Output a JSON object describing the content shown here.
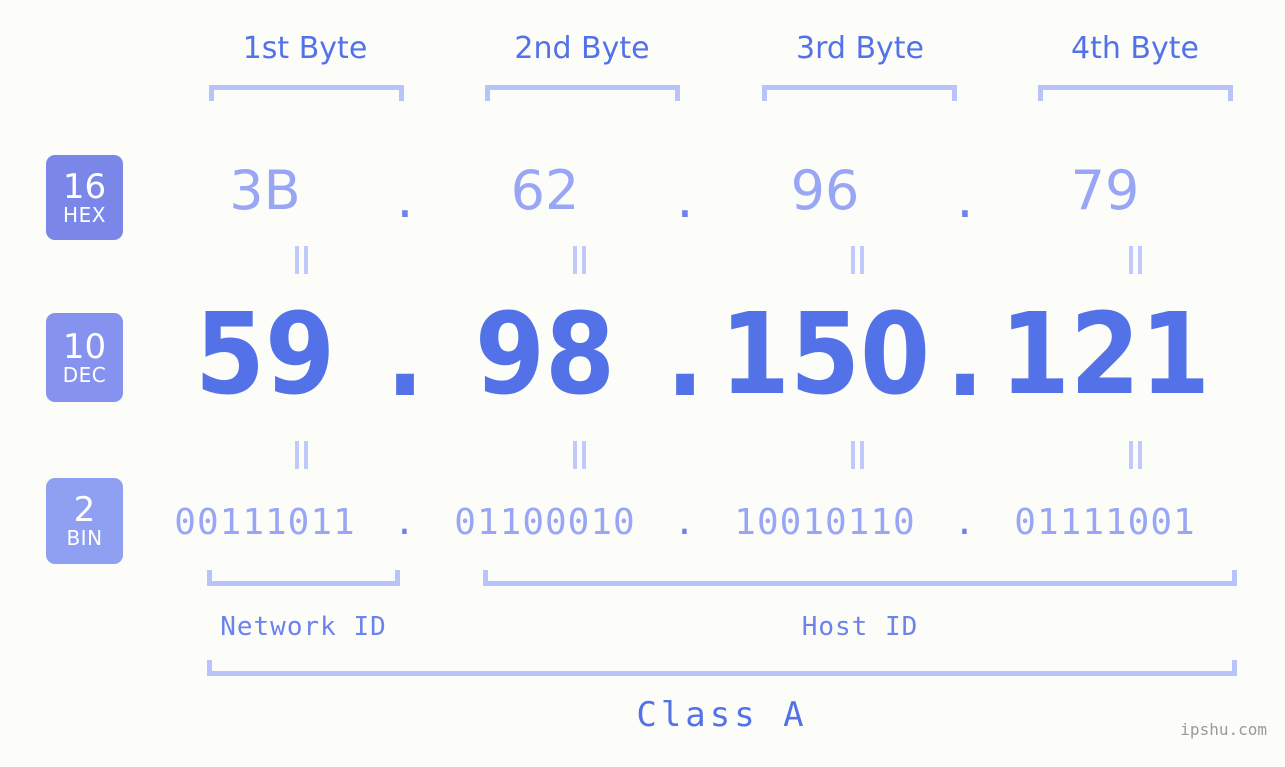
{
  "theme": {
    "background": "#fcfdf8",
    "accent_strong": "#5472e8",
    "accent_light": "#98a6f5",
    "bracket": "#b9c3fb",
    "badge_hex": "#7b87e8",
    "badge_dec": "#8592ee",
    "badge_bin": "#8fa0f2",
    "watermark": "#9a9a9a"
  },
  "byte_headers": [
    {
      "label": "1st Byte"
    },
    {
      "label": "2nd Byte"
    },
    {
      "label": "3rd Byte"
    },
    {
      "label": "4th Byte"
    }
  ],
  "radix_badges": [
    {
      "number": "16",
      "name": "HEX"
    },
    {
      "number": "10",
      "name": "DEC"
    },
    {
      "number": "2",
      "name": "BIN"
    }
  ],
  "rows": {
    "hex": {
      "octets": [
        "3B",
        "62",
        "96",
        "79"
      ],
      "separator": "."
    },
    "dec": {
      "octets": [
        "59",
        "98",
        "150",
        "121"
      ],
      "separator": "."
    },
    "bin": {
      "octets": [
        "00111011",
        "01100010",
        "10010110",
        "01111001"
      ],
      "separator": "."
    }
  },
  "equality_symbol": "=",
  "sections": [
    {
      "label": "Network ID"
    },
    {
      "label": "Host ID"
    }
  ],
  "class": {
    "label": "Class A"
  },
  "watermark": {
    "text": "ipshu.com"
  }
}
